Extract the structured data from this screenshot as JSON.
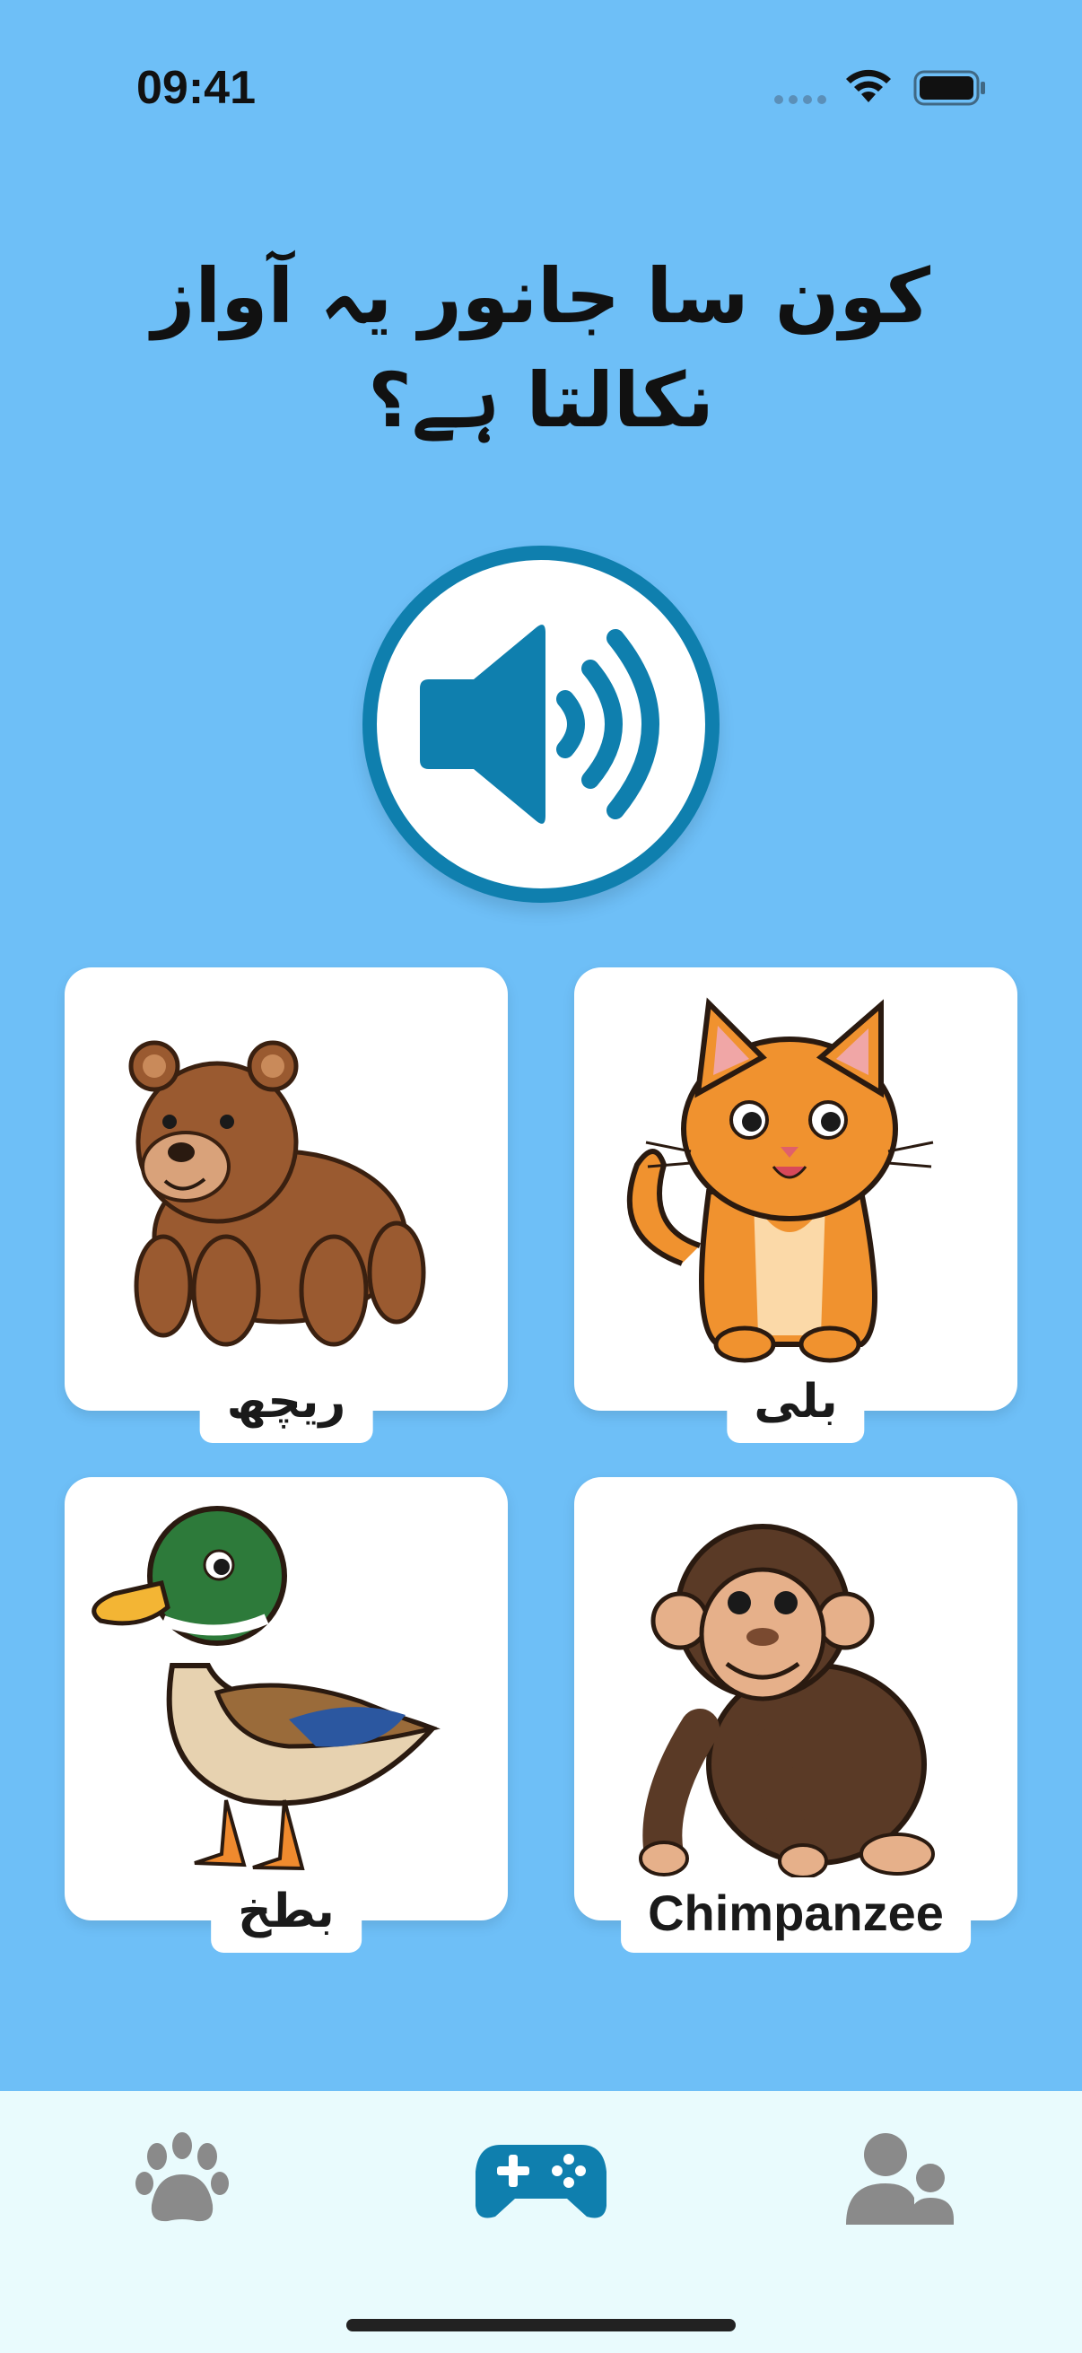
{
  "status_bar": {
    "time": "09:41",
    "icons": [
      "signal-dots-icon",
      "wifi-icon",
      "battery-icon"
    ]
  },
  "question": {
    "line1": "کون سا جانور یہ آواز",
    "line2": "نکالتا ہے؟"
  },
  "sound_button": {
    "icon": "speaker-icon",
    "accent": "#0f7fae"
  },
  "options": [
    {
      "label": "ریچھ",
      "icon": "bear-illustration"
    },
    {
      "label": "بلی",
      "icon": "cat-illustration"
    },
    {
      "label": "بطخ",
      "icon": "duck-illustration"
    },
    {
      "label": "Chimpanzee",
      "icon": "chimpanzee-illustration"
    }
  ],
  "tab_bar": {
    "tabs": [
      {
        "icon": "paw-icon",
        "active": false
      },
      {
        "icon": "gamepad-icon",
        "active": true
      },
      {
        "icon": "people-icon",
        "active": false
      }
    ],
    "active_color": "#0f7fae",
    "inactive_color": "#8a8a8a"
  },
  "colors": {
    "background": "#6ebff7",
    "tab_bar_bg": "#e9fbfd"
  }
}
